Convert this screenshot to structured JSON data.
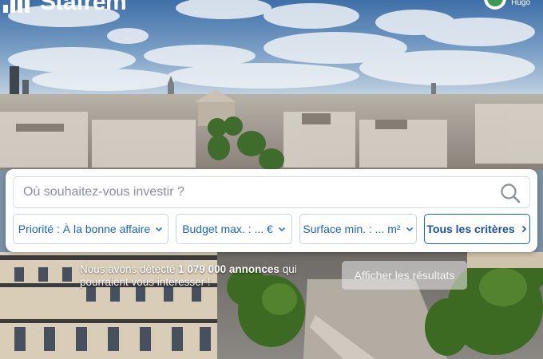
{
  "header": {
    "logo_text": "Stafrem",
    "user_name": "Hugo"
  },
  "search": {
    "placeholder": "Où souhaitez-vous investir ?",
    "value": ""
  },
  "filters": {
    "priority_label": "Priorité : À la bonne affaire",
    "budget_label": "Budget max. : ... €",
    "surface_label": "Surface min. : ... m²",
    "all_criteria_label": "Tous les critères"
  },
  "results": {
    "prefix": "Nous avons détecté",
    "count": "1 079 000 annonces",
    "suffix": "qui pourraient vous intéresser !",
    "button_label": "Afficher les résultats"
  },
  "colors": {
    "accent": "#1a63c7",
    "card_bg": "#ffffff",
    "avatar_green": "#3d9a54"
  },
  "icons": {
    "search": "search-icon",
    "chevron": "chevron-down-icon",
    "chevron_right": "chevron-right-icon"
  }
}
